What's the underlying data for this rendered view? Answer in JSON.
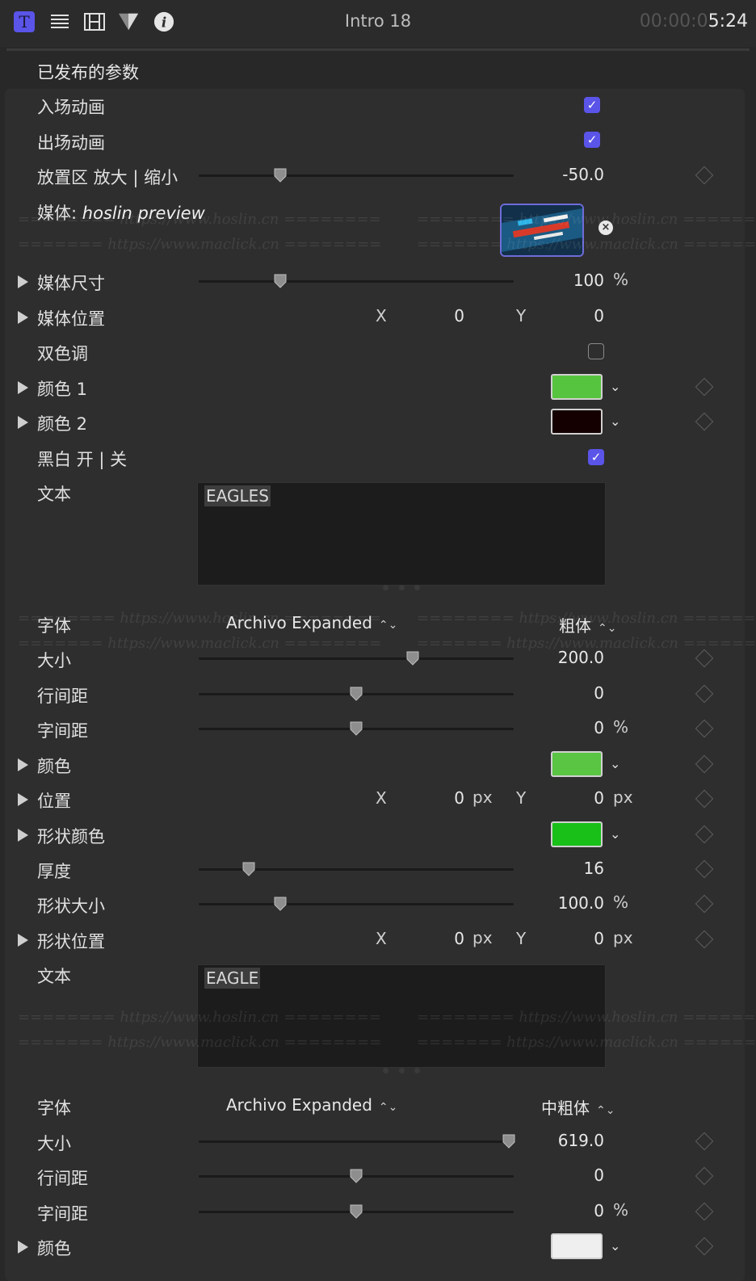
{
  "header": {
    "icons": [
      "text-tab-icon",
      "paragraph-tab-icon",
      "film-tab-icon",
      "filter-tab-icon",
      "info-tab-icon"
    ],
    "title": "Intro 18",
    "timecode_dim": "00:00:0",
    "timecode_bright": "5:24"
  },
  "section_title": "已发布的参数",
  "params": {
    "intro_anim": "入场动画",
    "outro_anim": "出场动画",
    "dropzone_scale": {
      "label": "放置区 放大 | 缩小",
      "value": "-50.0",
      "slider": 0.26
    },
    "media": {
      "label_prefix": "媒体:",
      "label_name": "hoslin preview"
    },
    "media_size": {
      "label": "媒体尺寸",
      "value": "100",
      "unit": "%",
      "slider": 0.26
    },
    "media_position": {
      "label": "媒体位置",
      "x_label": "X",
      "x_value": "0",
      "y_label": "Y",
      "y_value": "0"
    },
    "duotone": "双色调",
    "color1": {
      "label": "颜色 1",
      "color": "#57c43f"
    },
    "color2": {
      "label": "颜色 2",
      "color": "#140000"
    },
    "bw_toggle": "黑白 开 | 关",
    "text1": {
      "label": "文本",
      "value": "EAGLES"
    },
    "font1": {
      "label": "字体",
      "family": "Archivo Expanded",
      "weight": "粗体"
    },
    "size1": {
      "label": "大小",
      "value": "200.0",
      "slider": 0.68
    },
    "leading1": {
      "label": "行间距",
      "value": "0",
      "slider": 0.5
    },
    "tracking1": {
      "label": "字间距",
      "value": "0",
      "unit": "%",
      "slider": 0.5
    },
    "color_text1": {
      "label": "颜色",
      "color": "#5ac443"
    },
    "position1": {
      "label": "位置",
      "x_label": "X",
      "x_value": "0",
      "x_unit": "px",
      "y_label": "Y",
      "y_value": "0",
      "y_unit": "px"
    },
    "shape_color": {
      "label": "形状颜色",
      "color": "#18c018"
    },
    "thickness": {
      "label": "厚度",
      "value": "16",
      "slider": 0.16
    },
    "shape_size": {
      "label": "形状大小",
      "value": "100.0",
      "unit": "%",
      "slider": 0.26
    },
    "shape_position": {
      "label": "形状位置",
      "x_label": "X",
      "x_value": "0",
      "x_unit": "px",
      "y_label": "Y",
      "y_value": "0",
      "y_unit": "px"
    },
    "text2": {
      "label": "文本",
      "value": "EAGLE"
    },
    "font2": {
      "label": "字体",
      "family": "Archivo Expanded",
      "weight": "中粗体"
    },
    "size2": {
      "label": "大小",
      "value": "619.0",
      "slider": 0.985
    },
    "leading2": {
      "label": "行间距",
      "value": "0",
      "slider": 0.5
    },
    "tracking2": {
      "label": "字间距",
      "value": "0",
      "unit": "%",
      "slider": 0.5
    },
    "color_text2": {
      "label": "颜色",
      "color": "#efefef"
    }
  },
  "watermarks": {
    "hoslin": "======== https://www.hoslin.cn ========",
    "maclick": "======= https://www.maclick.cn ========"
  }
}
